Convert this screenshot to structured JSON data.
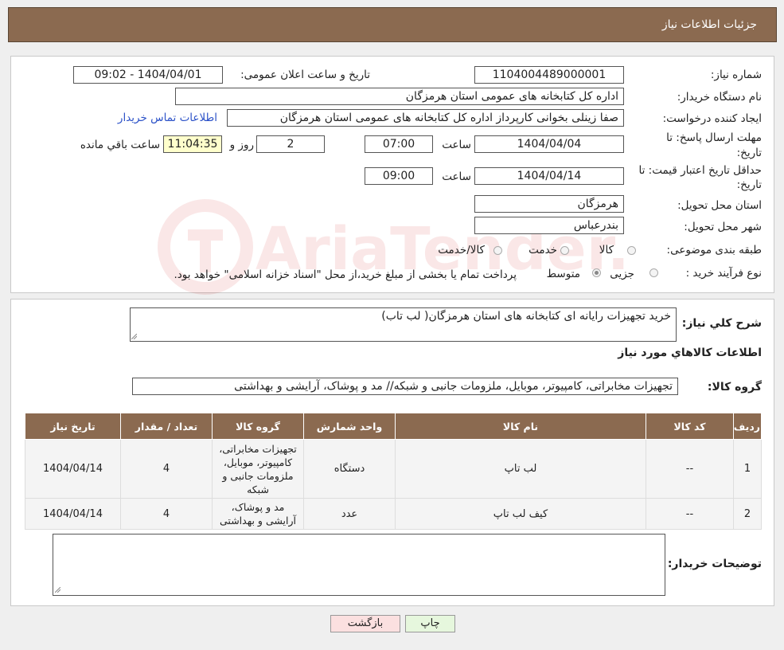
{
  "header": {
    "title": "جزئیات اطلاعات نیاز"
  },
  "info": {
    "need_number_label": "شماره نیاز:",
    "need_number": "1104004489000001",
    "announce_label": "تاریخ و ساعت اعلان عمومی:",
    "announce_value": "1404/04/01 - 09:02",
    "buyer_org_label": "نام دستگاه خریدار:",
    "buyer_org": "اداره کل کتابخانه های عمومی استان هرمزگان",
    "creator_label": "ایجاد کننده درخواست:",
    "creator": "صفا زینلی بخوانی کارپرداز اداره کل کتابخانه های عمومی استان هرمزگان",
    "contact_link": "اطلاعات تماس خریدار",
    "deadline_label_1": "مهلت ارسال پاسخ: تا",
    "deadline_label_2": "تاریخ:",
    "deadline_date": "1404/04/04",
    "hour_label": "ساعت",
    "deadline_time": "07:00",
    "days_value": "2",
    "days_label": "روز و",
    "remaining_time": "11:04:35",
    "remaining_label": "ساعت باقي مانده",
    "validity_label_1": "حداقل تاریخ اعتبار قیمت: تا",
    "validity_label_2": "تاریخ:",
    "validity_date": "1404/04/14",
    "validity_time": "09:00",
    "province_label": "استان محل تحویل:",
    "province": "هرمزگان",
    "city_label": "شهر محل تحویل:",
    "city": "بندرعباس",
    "category_label": "طبقه بندی موضوعی:",
    "category_options": [
      "کالا",
      "خدمت",
      "کالا/خدمت"
    ],
    "process_label": "نوع فرآیند خرید :",
    "process_options": [
      "جزیی",
      "متوسط"
    ],
    "process_note": "پرداخت تمام یا بخشی از مبلغ خرید،از محل \"اسناد خزانه اسلامی\" خواهد بود."
  },
  "summary": {
    "desc_label": "شرح کلي نياز:",
    "desc_value": "خرید تجهیزات رایانه ای کتابخانه های استان هرمزگان( لب تاب)",
    "goods_title": "اطلاعات کالاهاي مورد نياز",
    "group_label": "گروه کالا:",
    "group_value": "تجهیزات مخابراتی، کامپیوتر، موبایل، ملزومات جانبی و شبکه// مد و پوشاک، آرایشی و بهداشتی"
  },
  "table": {
    "headers": [
      "رديف",
      "کد کالا",
      "نام کالا",
      "واحد شمارش",
      "گروه کالا",
      "تعداد / مقدار",
      "تاریخ نیاز"
    ],
    "rows": [
      [
        "1",
        "--",
        "لب تاپ",
        "دستگاه",
        "تجهیزات مخابراتی، کامپیوتر، موبایل، ملزومات جانبی و شبکه",
        "4",
        "1404/04/14"
      ],
      [
        "2",
        "--",
        "کیف لب تاپ",
        "عدد",
        "مد و پوشاک، آرایشی و بهداشتی",
        "4",
        "1404/04/14"
      ]
    ]
  },
  "buyer_notes": {
    "label": "توضیحات خریدار:",
    "value": ""
  },
  "buttons": {
    "print": "چاپ",
    "back": "بازگشت"
  },
  "watermark": {
    "text": "AriaTender.neT"
  },
  "colors": {
    "header_bg": "#8b6a50",
    "print_btn": "#e6f7dd",
    "back_btn": "#fbe0e0",
    "link": "#2c52c8"
  }
}
